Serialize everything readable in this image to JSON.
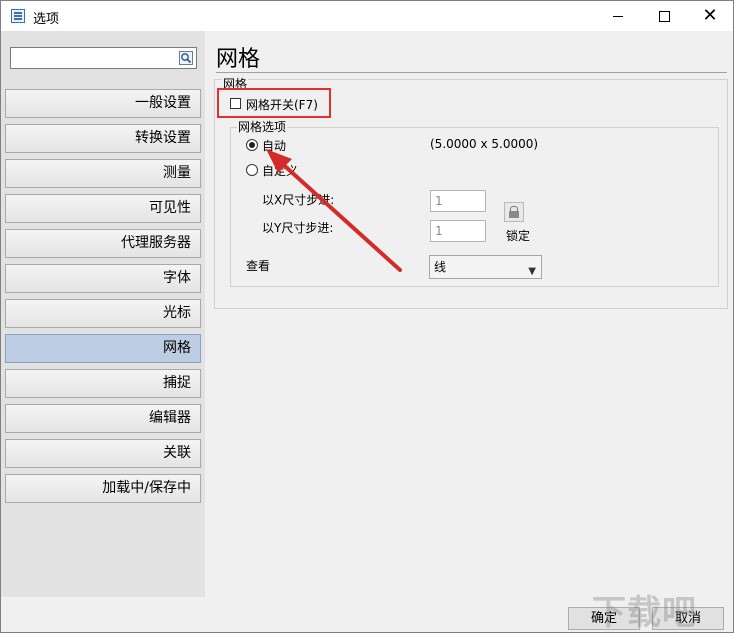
{
  "window": {
    "title": "选项"
  },
  "search": {
    "placeholder": ""
  },
  "sidebar": {
    "items": [
      {
        "label": "一般设置"
      },
      {
        "label": "转换设置"
      },
      {
        "label": "测量"
      },
      {
        "label": "可见性"
      },
      {
        "label": "代理服务器"
      },
      {
        "label": "字体"
      },
      {
        "label": "光标"
      },
      {
        "label": "网格"
      },
      {
        "label": "捕捉"
      },
      {
        "label": "编辑器"
      },
      {
        "label": "关联"
      },
      {
        "label": "加载中/保存中"
      }
    ],
    "active": "网格"
  },
  "main": {
    "title": "网格",
    "group_label": "网格",
    "grid_toggle_label": "网格开关(F7)",
    "options_label": "网格选项",
    "auto_label": "自动",
    "auto_value": "(5.0000 x 5.0000)",
    "custom_label": "自定义",
    "x_step_label": "以X尺寸步进:",
    "x_step_value": "1",
    "y_step_label": "以Y尺寸步进:",
    "y_step_value": "1",
    "lock_label": "锁定",
    "view_label": "查看",
    "view_value": "线"
  },
  "footer": {
    "ok": "确定",
    "cancel": "取消"
  },
  "watermark": "下载吧",
  "colors": {
    "annotation": "#e03030",
    "active_item": "#bccde3"
  }
}
